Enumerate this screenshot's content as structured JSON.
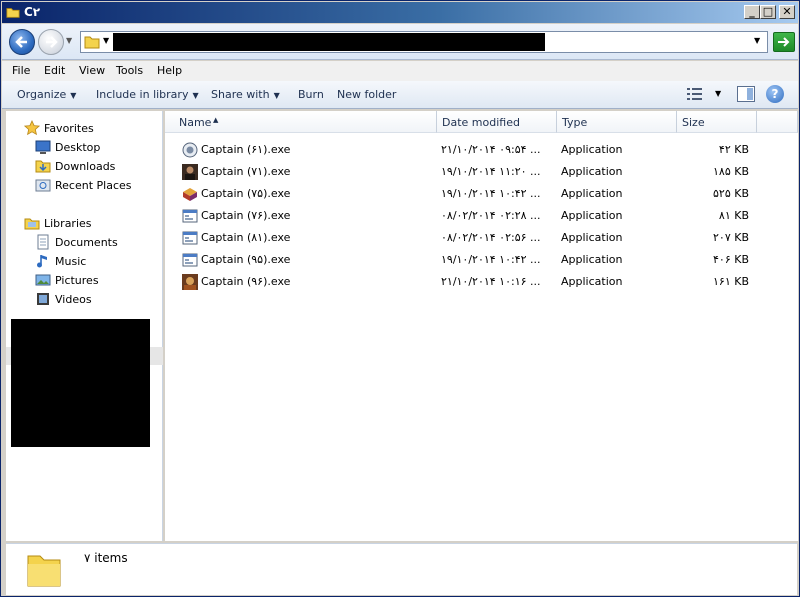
{
  "window": {
    "title": "C۲"
  },
  "menu": {
    "file": "File",
    "edit": "Edit",
    "view": "View",
    "tools": "Tools",
    "help": "Help"
  },
  "toolbar": {
    "organize": "Organize",
    "include_in_library": "Include in library",
    "share_with": "Share with",
    "burn": "Burn",
    "new_folder": "New folder"
  },
  "nav": {
    "favorites": "Favorites",
    "desktop": "Desktop",
    "downloads": "Downloads",
    "recent_places": "Recent Places",
    "libraries": "Libraries",
    "documents": "Documents",
    "music": "Music",
    "pictures": "Pictures",
    "videos": "Videos"
  },
  "columns": {
    "name": "Name",
    "date_modified": "Date modified",
    "type": "Type",
    "size": "Size"
  },
  "files": [
    {
      "name": "Captain (۶۱).exe",
      "date": "۲۱/۱۰/۲۰۱۴ ۰۹:۵۴ ...",
      "type": "Application",
      "size": "۴۲ KB",
      "icon": "gear-app-icon"
    },
    {
      "name": "Captain (۷۱).exe",
      "date": "۱۹/۱۰/۲۰۱۴ ۱۱:۲۰ ...",
      "type": "Application",
      "size": "۱۸۵ KB",
      "icon": "portrait-app-icon"
    },
    {
      "name": "Captain (۷۵).exe",
      "date": "۱۹/۱۰/۲۰۱۴ ۱۰:۴۲ ...",
      "type": "Application",
      "size": "۵۲۵ KB",
      "icon": "bricks-app-icon"
    },
    {
      "name": "Captain (۷۶).exe",
      "date": "۰۸/۰۲/۲۰۱۴ ۰۲:۲۸ ...",
      "type": "Application",
      "size": "۸۱ KB",
      "icon": "generic-exe-icon"
    },
    {
      "name": "Captain (۸۱).exe",
      "date": "۰۸/۰۲/۲۰۱۴ ۰۲:۵۶ ...",
      "type": "Application",
      "size": "۲۰۷ KB",
      "icon": "generic-exe-icon"
    },
    {
      "name": "Captain (۹۵).exe",
      "date": "۱۹/۱۰/۲۰۱۴ ۱۰:۴۲ ...",
      "type": "Application",
      "size": "۴۰۶ KB",
      "icon": "generic-exe-icon"
    },
    {
      "name": "Captain (۹۶).exe",
      "date": "۲۱/۱۰/۲۰۱۴ ۱۰:۱۶ ...",
      "type": "Application",
      "size": "۱۶۱ KB",
      "icon": "warrior-app-icon"
    }
  ],
  "status": {
    "item_count": "۷ items"
  },
  "colors": {
    "titlebar_start": "#0a246a",
    "titlebar_end": "#a6caf0",
    "accent": "#2d6bc0"
  }
}
